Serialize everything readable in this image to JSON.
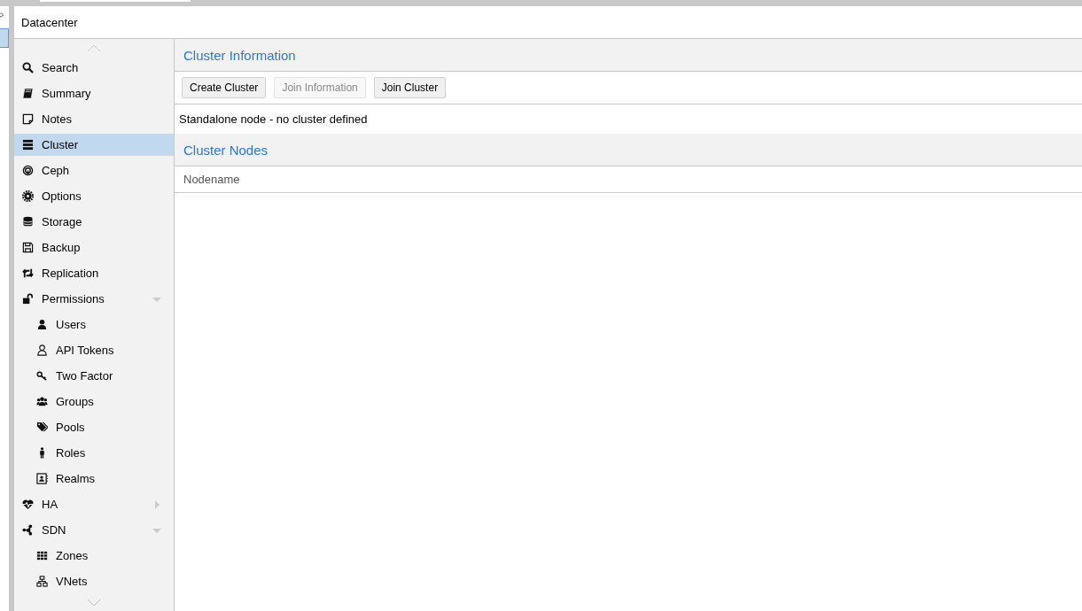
{
  "header": {
    "title": "Datacenter"
  },
  "sidebar": {
    "items": [
      {
        "label": "Search",
        "selected": false
      },
      {
        "label": "Summary",
        "selected": false
      },
      {
        "label": "Notes",
        "selected": false
      },
      {
        "label": "Cluster",
        "selected": true
      },
      {
        "label": "Ceph",
        "selected": false
      },
      {
        "label": "Options",
        "selected": false
      },
      {
        "label": "Storage",
        "selected": false
      },
      {
        "label": "Backup",
        "selected": false
      },
      {
        "label": "Replication",
        "selected": false
      },
      {
        "label": "Permissions",
        "selected": false,
        "expanded": true,
        "children": [
          {
            "label": "Users",
            "selected": false
          },
          {
            "label": "API Tokens",
            "selected": false
          },
          {
            "label": "Two Factor",
            "selected": false
          },
          {
            "label": "Groups",
            "selected": false
          },
          {
            "label": "Pools",
            "selected": false
          },
          {
            "label": "Roles",
            "selected": false
          },
          {
            "label": "Realms",
            "selected": false
          }
        ]
      },
      {
        "label": "HA",
        "selected": false,
        "expanded": false
      },
      {
        "label": "SDN",
        "selected": false,
        "expanded": true,
        "children": [
          {
            "label": "Zones",
            "selected": false
          },
          {
            "label": "VNets",
            "selected": false
          }
        ]
      }
    ]
  },
  "cluster_information": {
    "title": "Cluster Information",
    "buttons": [
      {
        "label": "Create Cluster",
        "disabled": false
      },
      {
        "label": "Join Information",
        "disabled": true
      },
      {
        "label": "Join Cluster",
        "disabled": false
      }
    ],
    "status": "Standalone node - no cluster defined"
  },
  "cluster_nodes": {
    "title": "Cluster Nodes",
    "columns": [
      "Nodename"
    ]
  }
}
